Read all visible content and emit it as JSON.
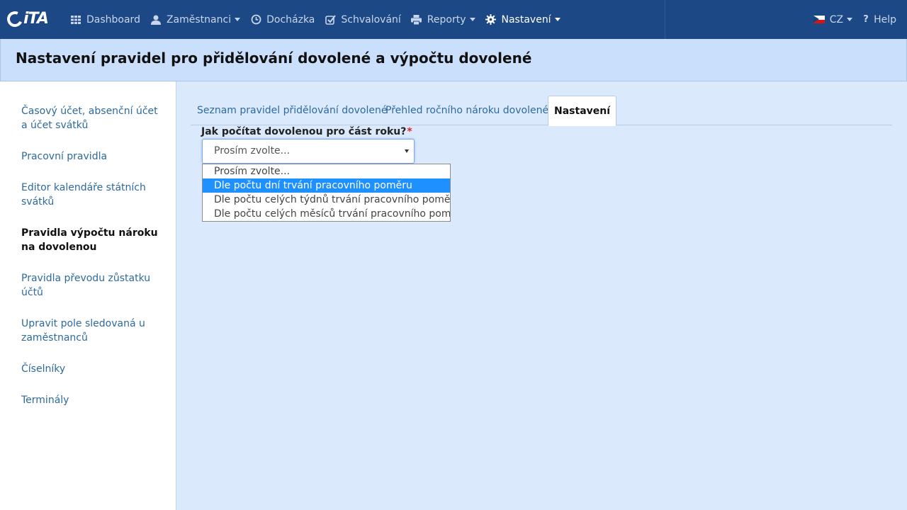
{
  "brand": {
    "name": "iTA"
  },
  "nav": {
    "items": [
      {
        "label": "Dashboard",
        "icon": "grid-icon",
        "has_caret": false
      },
      {
        "label": "Zaměstnanci",
        "icon": "user-icon",
        "has_caret": true
      },
      {
        "label": "Docházka",
        "icon": "clock-icon",
        "has_caret": false
      },
      {
        "label": "Schvalování",
        "icon": "check-icon",
        "has_caret": false
      },
      {
        "label": "Reporty",
        "icon": "printer-icon",
        "has_caret": true
      },
      {
        "label": "Nastavení",
        "icon": "gear-icon",
        "has_caret": true,
        "active": true
      }
    ],
    "language": "CZ",
    "help": "Help"
  },
  "page": {
    "title": "Nastavení pravidel pro přidělování dovolené a výpočtu dovolené"
  },
  "sidebar": {
    "items": [
      {
        "label": "Časový účet, absenční účet a účet svátků"
      },
      {
        "label": "Pracovní pravidla"
      },
      {
        "label": "Editor kalendáře státních svátků"
      },
      {
        "label": "Pravidla výpočtu nároku na dovolenou",
        "active": true
      },
      {
        "label": "Pravidla převodu zůstatku účtů"
      },
      {
        "label": "Upravit pole sledovaná u zaměstnanců"
      },
      {
        "label": "Číselníky"
      },
      {
        "label": "Terminály"
      }
    ]
  },
  "tabs": [
    {
      "label": "Seznam pravidel přidělování dovolené"
    },
    {
      "label": "Přehled ročního nároku dovolené"
    },
    {
      "label": "Nastavení",
      "active": true
    }
  ],
  "form": {
    "label": "Jak počítat dovolenou pro část roku?",
    "required_mark": "*",
    "selected": "Prosím zvolte...",
    "options": [
      "Prosím zvolte...",
      "Dle počtu dní trvání pracovního poměru",
      "Dle počtu celých týdnů trvání pracovního poměru",
      "Dle počtu celých měsíců trvání pracovního poměru"
    ],
    "highlighted_option": "Dle počtu dní trvání pracovního poměru"
  },
  "colors": {
    "navbar": "#1d4886",
    "header": "#c9dffb",
    "main_bg": "#dbe9fc",
    "link": "#2c6aa0",
    "highlight": "#1e90ff",
    "required": "#d9262c"
  }
}
